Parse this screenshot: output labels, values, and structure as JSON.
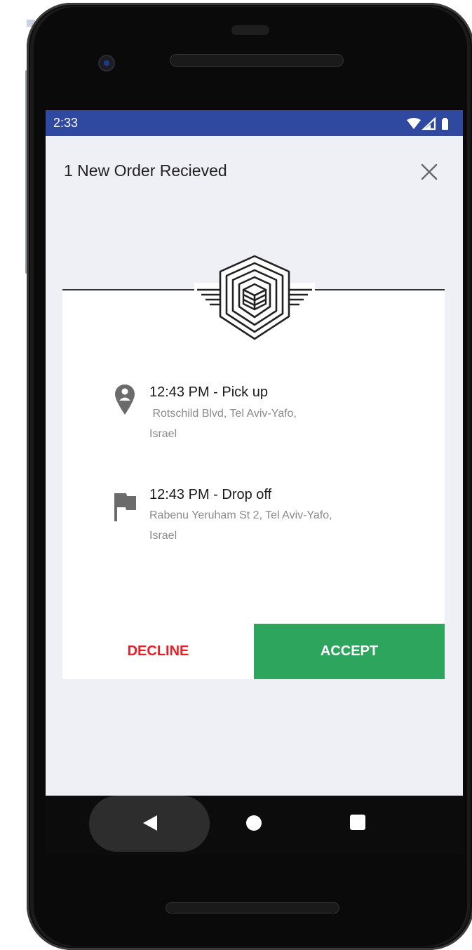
{
  "status_bar": {
    "time": "2:33",
    "icons": [
      "wifi-icon",
      "signal-icon",
      "battery-icon"
    ],
    "color": "#2f48a0"
  },
  "header": {
    "title": "1 New Order Recieved",
    "close_icon": "close-icon"
  },
  "order": {
    "logo_icon": "hexagon-cube-logo",
    "pickup": {
      "icon": "location-pin-icon",
      "time": "12:43 PM - Pick up",
      "address_line1": " Rotschild Blvd, Tel Aviv-Yafo,",
      "address_line2": "Israel"
    },
    "dropoff": {
      "icon": "flag-icon",
      "time": "12:43 PM - Drop off",
      "address_line1": "Rabenu Yeruham St 2, Tel Aviv-Yafo,",
      "address_line2": "Israel"
    }
  },
  "actions": {
    "decline_label": "DECLINE",
    "accept_label": "ACCEPT",
    "decline_color": "#ee1c24",
    "accept_color": "#2ea55d"
  },
  "nav": {
    "back_icon": "back-triangle-icon",
    "home_icon": "home-circle-icon",
    "recents_icon": "recents-square-icon"
  }
}
